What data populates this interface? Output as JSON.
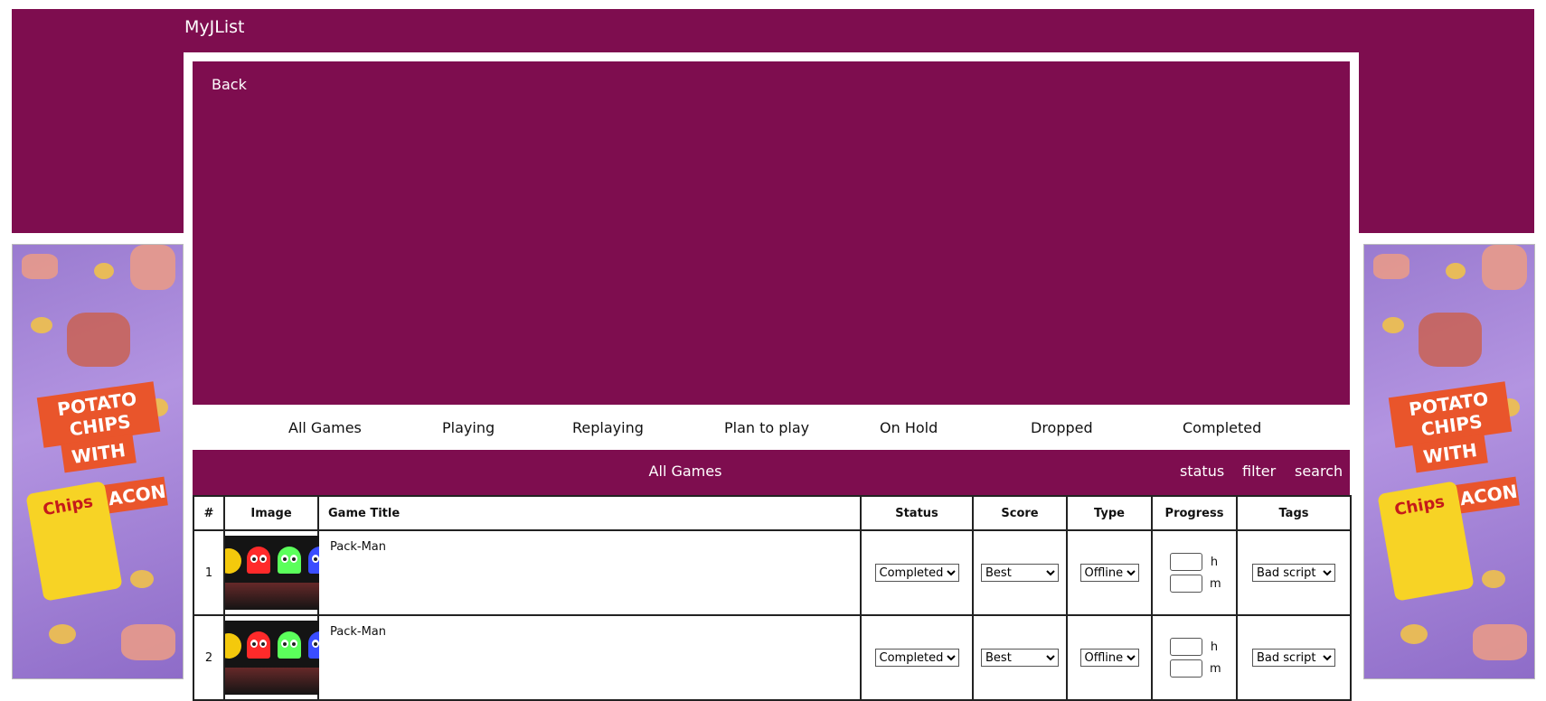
{
  "app": {
    "brand": "MyJList"
  },
  "banner": {
    "back_label": "Back"
  },
  "tabs": [
    "All Games",
    "Playing",
    "Replaying",
    "Plan to play",
    "On Hold",
    "Dropped",
    "Completed"
  ],
  "list_header": {
    "title": "All Games",
    "links": [
      "status",
      "filter",
      "search"
    ]
  },
  "table": {
    "columns": [
      "#",
      "Image",
      "Game Title",
      "Status",
      "Score",
      "Type",
      "Progress",
      "Tags"
    ],
    "rows": [
      {
        "num": "1",
        "title": "Pack-Man",
        "status": "Completed",
        "score": "Best",
        "type": "Offline",
        "tags": "Bad script"
      },
      {
        "num": "2",
        "title": "Pack-Man",
        "status": "Completed",
        "score": "Best",
        "type": "Offline",
        "tags": "Bad script"
      }
    ],
    "progress_units": {
      "hours": "h",
      "minutes": "m"
    }
  },
  "ads": {
    "text_lines": [
      "POTATO CHIPS",
      "WITH",
      "BACON"
    ],
    "brand": "Chips"
  },
  "colors": {
    "brand": "#7e0d4f",
    "ad_background": "#a182d6",
    "ad_ribbon": "#e9552b"
  }
}
